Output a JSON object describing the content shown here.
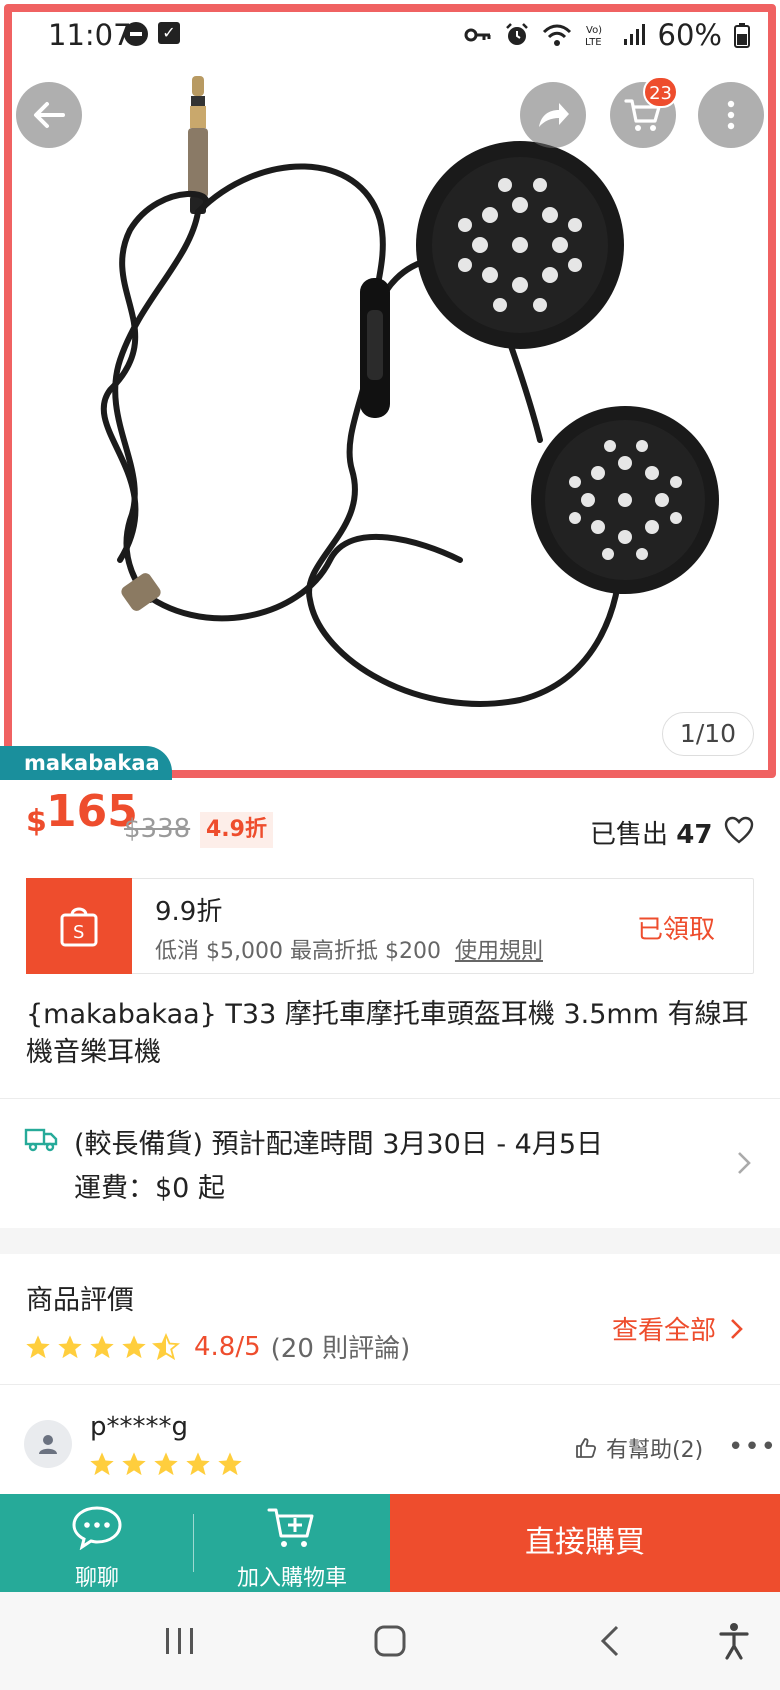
{
  "status_bar": {
    "time": "11:07",
    "battery": "60%",
    "icons": [
      "minus-circle-icon",
      "checkbox-icon",
      "key-icon",
      "alarm-icon",
      "wifi-icon",
      "volte-icon",
      "signal-icon",
      "battery-icon"
    ]
  },
  "header": {
    "back_icon": "back-arrow-icon",
    "share_icon": "share-icon",
    "cart_icon": "cart-icon",
    "cart_count": "23",
    "more_icon": "more-vertical-icon"
  },
  "gallery": {
    "counter": "1/10",
    "shop_tag": "makabakaa"
  },
  "price": {
    "currency": "$",
    "current": "165",
    "original": "$338",
    "discount": "4.9折",
    "sold_label": "已售出",
    "sold_count": "47"
  },
  "voucher": {
    "title": "9.9折",
    "desc": "低消 $5,000 最高折抵 $200",
    "rules_link": "使用規則",
    "status": "已領取"
  },
  "product": {
    "title": "{makabakaa} T33 摩托車摩托車頭盔耳機 3.5mm 有線耳機音樂耳機"
  },
  "shipping": {
    "line1": "(較長備貨) 預計配達時間 3月30日 - 4月5日",
    "line2": "運費：$0 起"
  },
  "reviews": {
    "title": "商品評價",
    "rating": 4.8,
    "rating_text": "4.8/5",
    "count_text": "(20 則評論)",
    "view_all": "查看全部"
  },
  "review_item": {
    "user": "p*****g",
    "stars": 5,
    "helpful": "有幫助(2)",
    "more": "•••"
  },
  "action_bar": {
    "chat": "聊聊",
    "add_to_cart": "加入購物車",
    "buy_now": "直接購買"
  },
  "colors": {
    "accent": "#ee4d2d",
    "teal": "#26aa99",
    "star": "#ffce3d",
    "frame": "#f06262"
  }
}
